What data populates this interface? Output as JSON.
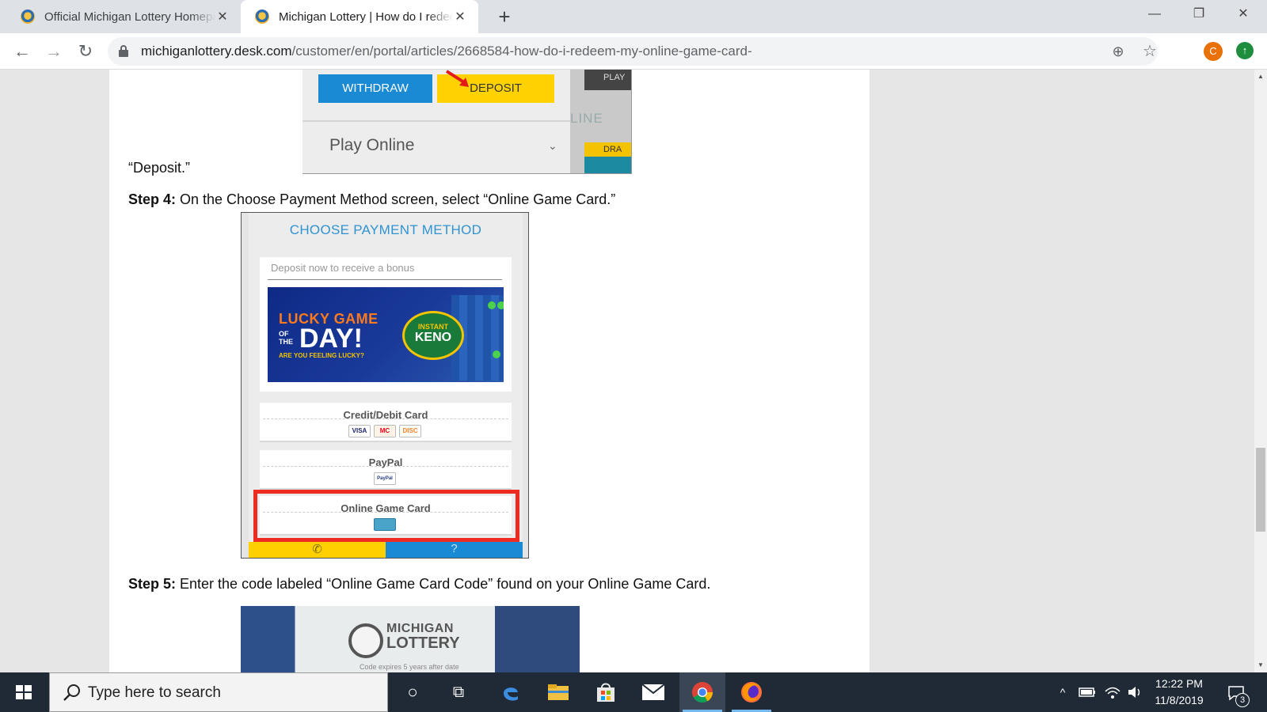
{
  "browser": {
    "tabs": [
      {
        "title": "Official Michigan Lottery Homepage",
        "close": "✕"
      },
      {
        "title": "Michigan Lottery | How do I redeem my online game card",
        "close": "✕"
      }
    ],
    "new_tab": "+",
    "window_controls": {
      "minimize": "—",
      "restore": "❐",
      "close": "✕"
    },
    "nav": {
      "back": "←",
      "forward": "→",
      "reload": "↻"
    },
    "url": {
      "host": "michiganlottery.desk.com",
      "path": "/customer/en/portal/articles/2668584-how-do-i-redeem-my-online-game-card-"
    },
    "zoom_icon": "⊕",
    "bookmark_icon": "☆",
    "profile_initial": "C",
    "update_icon": "↑"
  },
  "article": {
    "deposit_caption": "“Deposit.”",
    "deposit_image": {
      "withdraw": "WITHDRAW",
      "deposit": "DEPOSIT",
      "play_online": "Play Online",
      "chevron": "⌄",
      "side_play": "PLAY",
      "side_online": "LINE",
      "side_draw": "DRA"
    },
    "step4_label": "Step 4:",
    "step4_text": " On the Choose Payment Method screen, select “Online Game Card.”",
    "payment_image": {
      "title": "CHOOSE PAYMENT METHOD",
      "promo_placeholder": "Deposit now to receive a bonus",
      "banner": {
        "lucky_game": "LUCKY GAME",
        "of_the": "OF THE",
        "day": "DAY!",
        "tagline": "ARE YOU FEELING LUCKY?",
        "instant": "INSTANT",
        "keno": "KENO"
      },
      "options": [
        {
          "label": "Credit/Debit Card",
          "logos": [
            "VISA",
            "MC",
            "DISC"
          ]
        },
        {
          "label": "PayPal",
          "logos": [
            "PayPal"
          ]
        },
        {
          "label": "Online Game Card",
          "logos": [
            "card"
          ]
        }
      ],
      "footer_left_icon": "✆",
      "footer_right_icon": "?"
    },
    "step5_label": "Step 5:",
    "step5_text": " Enter the code labeled “Online Game Card Code” found on your Online Game Card.",
    "card_image": {
      "michigan": "MICHIGAN",
      "lottery": "LOTTERY",
      "fine_print": "Code expires 5 years after date"
    }
  },
  "taskbar": {
    "search_placeholder": "Type here to search",
    "cortana_icon": "○",
    "task_view_icon": "⧉",
    "tray_chevron": "^",
    "time": "12:22 PM",
    "date": "11/8/2019",
    "notifications": "3"
  },
  "colors": {
    "deposit_yellow": "#ffd200",
    "withdraw_blue": "#1a8ad4",
    "highlight_red": "#ee2b20",
    "title_blue": "#2f93d1"
  }
}
